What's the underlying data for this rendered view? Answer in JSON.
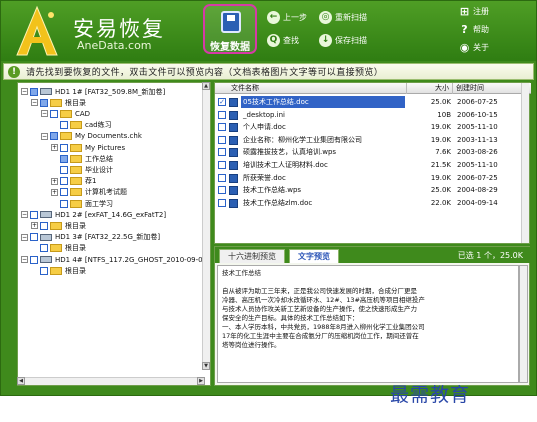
{
  "app": {
    "title": "安易恢复",
    "subtitle": "AneData.com"
  },
  "toolbar": {
    "recover_label": "恢复数据",
    "prev_label": "上一步",
    "rescan_label": "重新扫描",
    "find_label": "查找",
    "save_scan_label": "保存扫描",
    "register_label": "注册",
    "help_label": "帮助",
    "about_label": "关于"
  },
  "message": "请先找到要恢复的文件，双击文件可以预览内容（文档表格图片文字等可以直接预览）",
  "tree": [
    {
      "indent": 0,
      "expander": "-",
      "check": "part",
      "icon": "disk",
      "label": "HD1  1# [FAT32_509.8M_新加卷]"
    },
    {
      "indent": 1,
      "expander": "-",
      "check": "part",
      "icon": "folder",
      "label": "根目录"
    },
    {
      "indent": 2,
      "expander": "-",
      "check": "none",
      "icon": "folder",
      "label": "CAD"
    },
    {
      "indent": 3,
      "expander": "",
      "check": "none",
      "icon": "folder",
      "label": "cad练习"
    },
    {
      "indent": 2,
      "expander": "-",
      "check": "part",
      "icon": "folder",
      "label": "My Documents.chk"
    },
    {
      "indent": 3,
      "expander": "+",
      "check": "none",
      "icon": "folder",
      "label": "My Pictures"
    },
    {
      "indent": 3,
      "expander": "",
      "check": "part",
      "icon": "folder",
      "label": "工作总结"
    },
    {
      "indent": 3,
      "expander": "",
      "check": "none",
      "icon": "folder",
      "label": "毕业设计"
    },
    {
      "indent": 3,
      "expander": "+",
      "check": "none",
      "icon": "folder",
      "label": "荐1"
    },
    {
      "indent": 3,
      "expander": "+",
      "check": "none",
      "icon": "folder",
      "label": "计算机考试题"
    },
    {
      "indent": 3,
      "expander": "",
      "check": "none",
      "icon": "folder",
      "label": "面工学习"
    },
    {
      "indent": 0,
      "expander": "-",
      "check": "none",
      "icon": "disk",
      "label": "HD1  2# [exFAT_14.6G_exFatT2]"
    },
    {
      "indent": 1,
      "expander": "+",
      "check": "none",
      "icon": "folder",
      "label": "根目录"
    },
    {
      "indent": 0,
      "expander": "-",
      "check": "none",
      "icon": "disk",
      "label": "HD1  3# [FAT32_22.5G_新加卷]"
    },
    {
      "indent": 1,
      "expander": "",
      "check": "none",
      "icon": "folder",
      "label": "根目录"
    },
    {
      "indent": 0,
      "expander": "-",
      "check": "none",
      "icon": "disk",
      "label": "HD1  4# [NTFS_117.2G_GHOST_2010-09-03]"
    },
    {
      "indent": 1,
      "expander": "",
      "check": "none",
      "icon": "folder",
      "label": "根目录"
    }
  ],
  "filelist": {
    "headers": {
      "name": "文件名称",
      "size": "大小",
      "date": "创建时间"
    },
    "rows": [
      {
        "checked": true,
        "selected": true,
        "name": "05技术工作总结.doc",
        "size": "25.0K",
        "date": "2006-07-25"
      },
      {
        "checked": false,
        "selected": false,
        "name": "_desktop.ini",
        "size": "10B",
        "date": "2006-10-15"
      },
      {
        "checked": false,
        "selected": false,
        "name": "个人申请.doc",
        "size": "19.0K",
        "date": "2005-11-10"
      },
      {
        "checked": false,
        "selected": false,
        "name": "企业名称：柳州化学工业集团有限公司",
        "size": "19.0K",
        "date": "2003-11-13"
      },
      {
        "checked": false,
        "selected": false,
        "name": "硕露推拔技艺，认真培训.wps",
        "size": "7.6K",
        "date": "2003-08-26"
      },
      {
        "checked": false,
        "selected": false,
        "name": "培训技术工人证明材料.doc",
        "size": "21.5K",
        "date": "2005-11-10"
      },
      {
        "checked": false,
        "selected": false,
        "name": "所获荣誉.doc",
        "size": "19.0K",
        "date": "2006-07-25"
      },
      {
        "checked": false,
        "selected": false,
        "name": "技术工作总结.wps",
        "size": "25.0K",
        "date": "2004-08-29"
      },
      {
        "checked": false,
        "selected": false,
        "name": "技术工作总结zlm.doc",
        "size": "22.0K",
        "date": "2004-09-14"
      }
    ]
  },
  "preview": {
    "tab_hex": "十六进制预览",
    "tab_text": "文字预览",
    "status": "已选 1 个，25.0K",
    "lines": [
      "技术工作总结",
      "",
      "自从被评为助工三年来，正是我公司快速发展的时期，合成分厂更是",
      "冷器、高压机一次冷却水改循环水、12#、13#高压机等项目相继投产",
      "与技术人员协作攻关新工艺新设备的生产操作，使之快速形成生产力",
      "保安全的生产目标。具体的技术工作总结如下：",
      "一、本人学历本科，中共党员，1988年8月进入柳州化学工业集团公司",
      "17年的化工生涯中主要在合成氨分厂的压缩机岗位工作，期间还曾在",
      "塔等岗位进行操作。"
    ]
  },
  "watermark": "最需教育"
}
